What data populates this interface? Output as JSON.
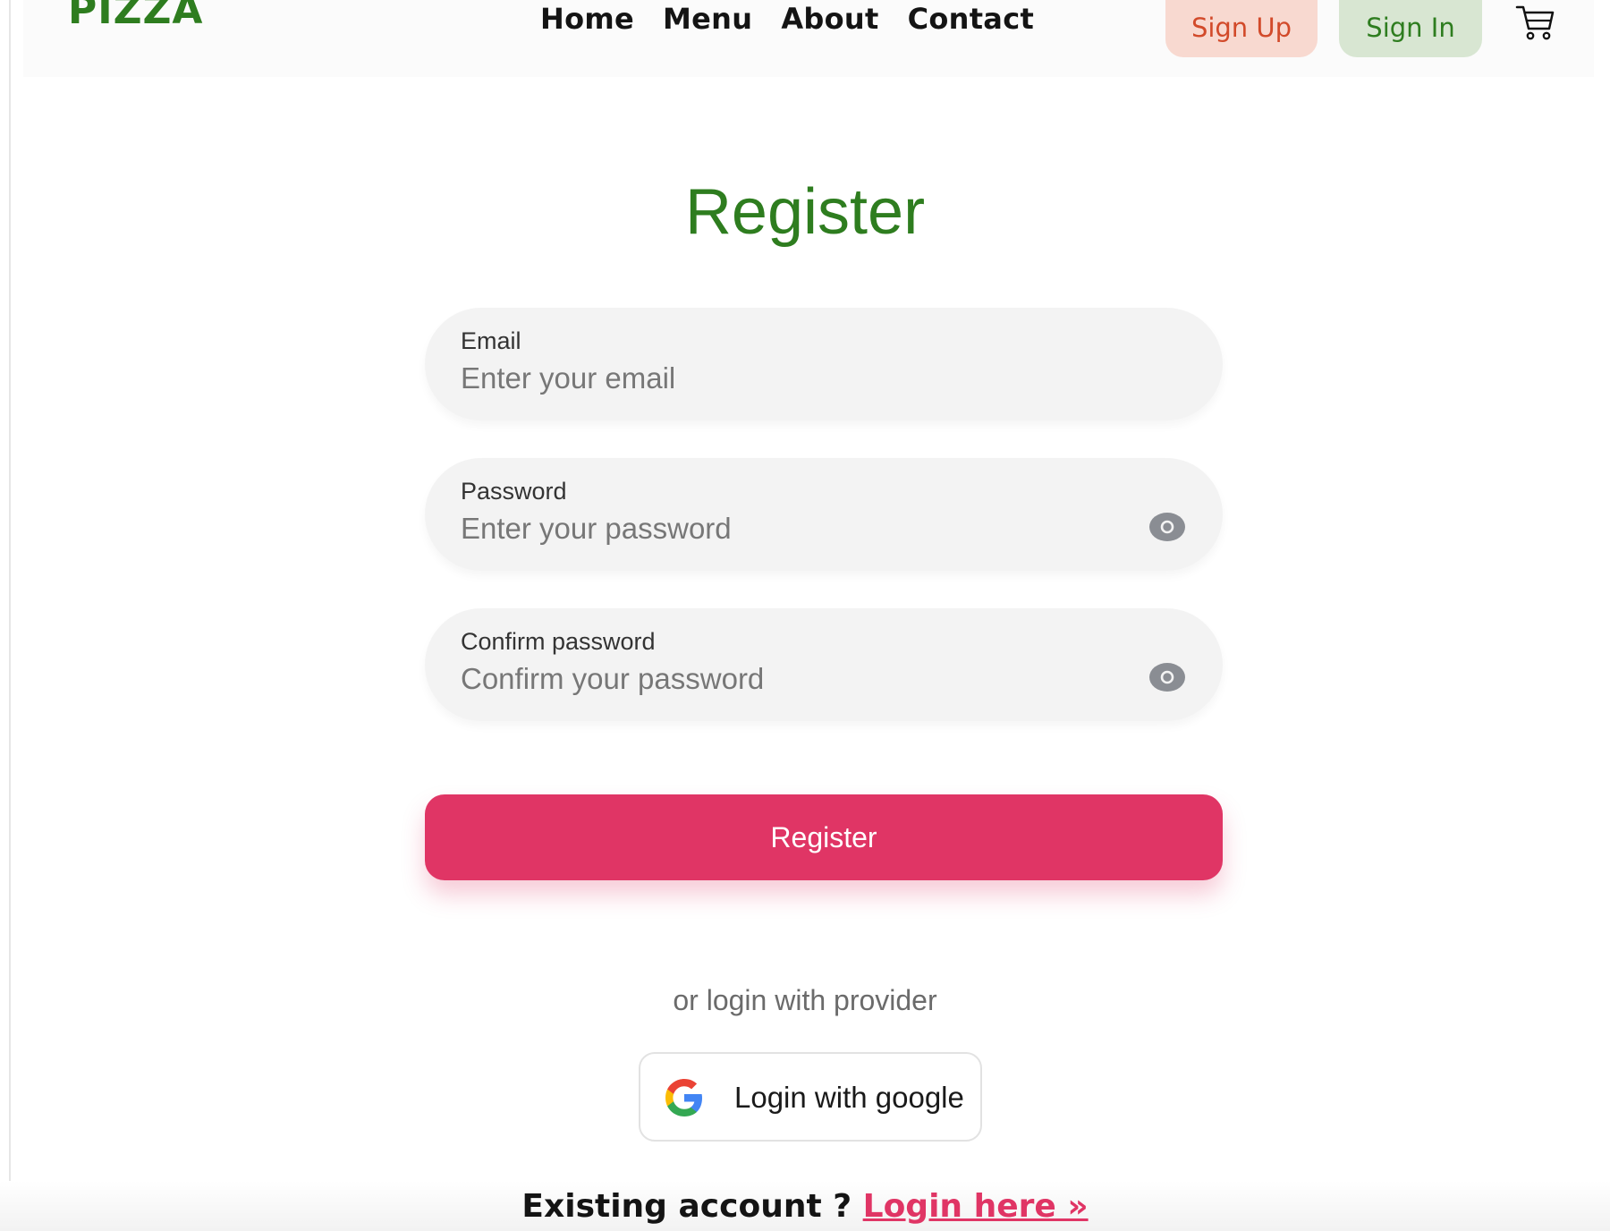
{
  "header": {
    "logo": "PIZZA",
    "nav": [
      "Home",
      "Menu",
      "About",
      "Contact"
    ],
    "sign_up": "Sign Up",
    "sign_in": "Sign In",
    "cart_icon": "cart-icon"
  },
  "form": {
    "title": "Register",
    "email": {
      "label": "Email",
      "placeholder": "Enter your email"
    },
    "password": {
      "label": "Password",
      "placeholder": "Enter your password",
      "icon": "eye-icon"
    },
    "confirm": {
      "label": "Confirm password",
      "placeholder": "Confirm your password",
      "icon": "eye-icon"
    },
    "submit": "Register",
    "provider_text": "or login with provider",
    "google": "Login with google",
    "existing": "Existing account ?",
    "login_link": "Login here »"
  },
  "colors": {
    "brand_green": "#2e7d1f",
    "accent_pink": "#e03565",
    "signup_bg": "#f8d9d0",
    "signin_bg": "#d8e6d2"
  }
}
